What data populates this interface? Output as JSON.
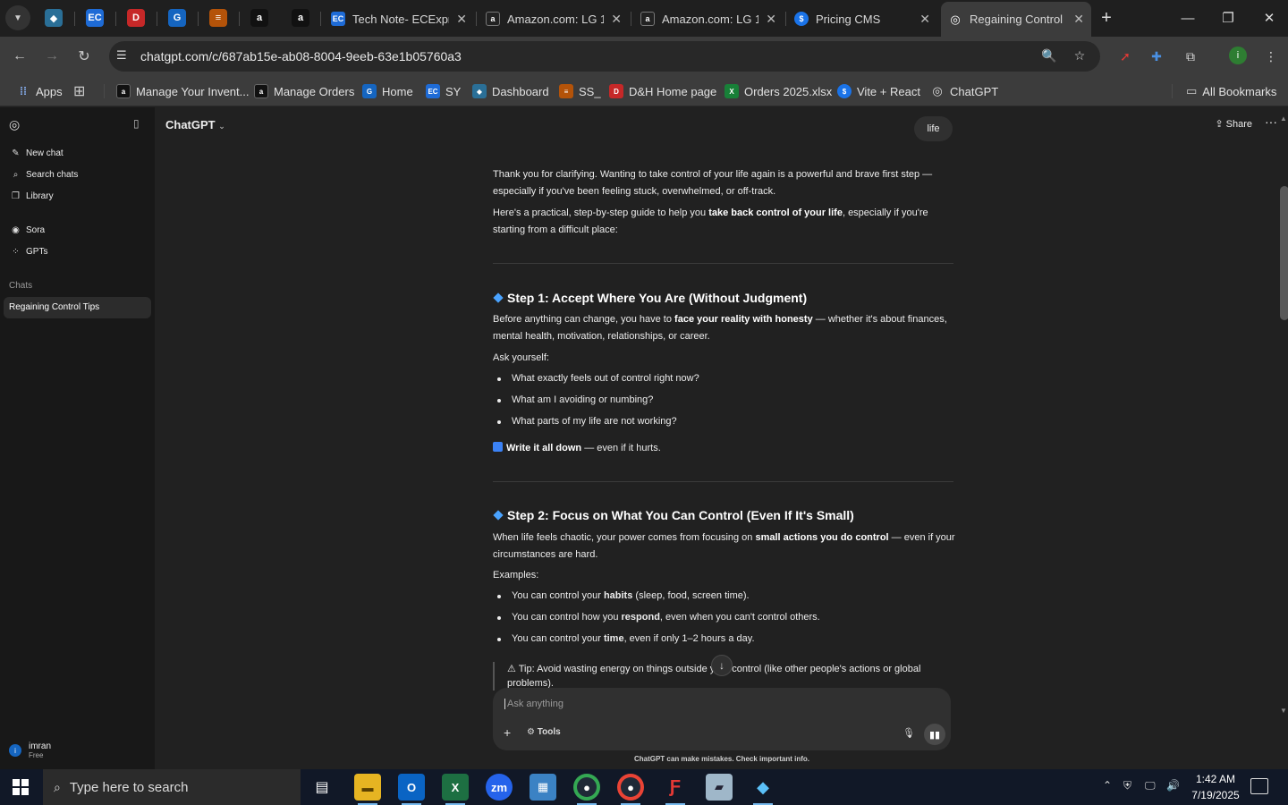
{
  "browser": {
    "tabs": [
      {
        "title": "Tech Note- ECExpr",
        "fav": "EC",
        "color": "#1e6bd6"
      },
      {
        "title": "Amazon.com: LG 1",
        "fav": "a",
        "color": "#111111"
      },
      {
        "title": "Amazon.com: LG 1",
        "fav": "a",
        "color": "#111111"
      },
      {
        "title": "Pricing CMS",
        "fav": "$",
        "color": "#1a73e8"
      },
      {
        "title": "Regaining Control",
        "fav": "◎",
        "color": "#3c3c3c"
      }
    ],
    "url": "chatgpt.com/c/687ab15e-ab08-8004-9eeb-63e1b05760a3",
    "bookmarks": [
      {
        "label": "Apps"
      },
      {
        "label": "Manage Your Invent..."
      },
      {
        "label": "Manage Orders"
      },
      {
        "label": "Home"
      },
      {
        "label": "SY"
      },
      {
        "label": "Dashboard"
      },
      {
        "label": "SS_"
      },
      {
        "label": "D&H Home page"
      },
      {
        "label": "Orders 2025.xlsx"
      },
      {
        "label": "Vite + React"
      },
      {
        "label": "ChatGPT"
      }
    ],
    "all_bookmarks": "All Bookmarks"
  },
  "sidebar": {
    "new_chat": "New chat",
    "search_chats": "Search chats",
    "library": "Library",
    "sora": "Sora",
    "gpts": "GPTs",
    "chats_heading": "Chats",
    "active_chat": "Regaining Control Tips",
    "user_name": "imran",
    "user_plan": "Free",
    "user_initial": "i"
  },
  "main": {
    "model": "ChatGPT",
    "share": "Share",
    "user_message": "life",
    "intro1": "Thank you for clarifying. Wanting to take control of your life again is a powerful and brave first step — especially if you've been feeling stuck, overwhelmed, or off-track.",
    "intro2_a": "Here's a practical, step-by-step guide to help you ",
    "intro2_b": "take back control of your life",
    "intro2_c": ", especially if you're starting from a difficult place:",
    "step1_title": "Step 1: Accept Where You Are (Without Judgment)",
    "step1_p_a": "Before anything can change, you have to ",
    "step1_p_b": "face your reality with honesty",
    "step1_p_c": " — whether it's about finances, mental health, motivation, relationships, or career.",
    "ask_yourself": "Ask yourself:",
    "step1_bullets": [
      "What exactly feels out of control right now?",
      "What am I avoiding or numbing?",
      "What parts of my life are not working?"
    ],
    "write_down_b": "Write it all down",
    "write_down_rest": " — even if it hurts.",
    "step2_title": "Step 2: Focus on What You Can Control (Even If It's Small)",
    "step2_p_a": "When life feels chaotic, your power comes from focusing on ",
    "step2_p_b": "small actions you do control",
    "step2_p_c": " — even if your circumstances are hard.",
    "examples": "Examples:",
    "step2_b1_a": "You can control your ",
    "step2_b1_b": "habits",
    "step2_b1_c": " (sleep, food, screen time).",
    "step2_b2_a": "You can control how you ",
    "step2_b2_b": "respond",
    "step2_b2_c": ", even when you can't control others.",
    "step2_b3_a": "You can control your ",
    "step2_b3_b": "time",
    "step2_b3_c": ", even if only 1–2 hours a day.",
    "tip": "⚠ Tip: Avoid wasting energy on things outside your control (like other people's actions or global problems).",
    "composer_placeholder": "Ask anything",
    "tools": "Tools",
    "disclaimer": "ChatGPT can make mistakes. Check important info."
  },
  "taskbar": {
    "search_placeholder": "Type here to search",
    "time": "1:42 AM",
    "date": "7/19/2025"
  }
}
